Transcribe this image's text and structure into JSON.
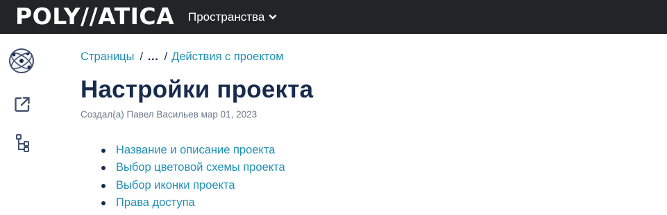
{
  "header": {
    "logo_text": "POLY//ATICA",
    "spaces_label": "Пространства",
    "background": "#222427"
  },
  "sidebar": {
    "icons": [
      "globe-atom-icon",
      "external-link-icon",
      "page-tree-icon"
    ]
  },
  "breadcrumb": {
    "items": [
      "Страницы",
      "…",
      "Действия с проектом"
    ],
    "separator": "/"
  },
  "page": {
    "title": "Настройки проекта",
    "byline": "Создал(а) Павел Васильев мар 01, 2023"
  },
  "toc": {
    "items": [
      "Название и описание проекта",
      "Выбор цветовой схемы проекта",
      "Выбор иконки проекта",
      "Права доступа"
    ]
  },
  "colors": {
    "link": "#1f8fb4",
    "text": "#172b4d",
    "muted": "#6b778c"
  }
}
